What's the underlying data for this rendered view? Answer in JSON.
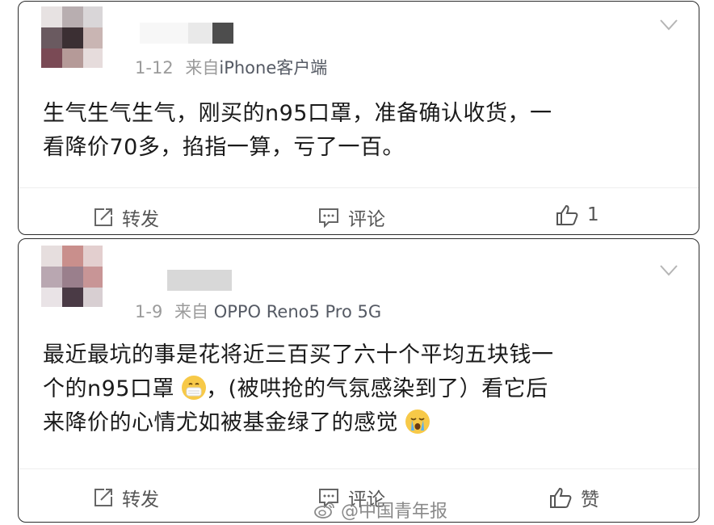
{
  "posts": [
    {
      "meta_date": "1-12",
      "meta_from": "来自",
      "meta_source": "iPhone客户端",
      "content_lines": [
        "生气生气生气，刚买的n95口罩，准备确认收货，一",
        "看降价70多，掐指一算，亏了一百。"
      ],
      "actions": {
        "repost": "转发",
        "comment": "评论",
        "like": "1"
      }
    },
    {
      "meta_date": "1-9",
      "meta_from": "来自",
      "meta_source": "OPPO Reno5 Pro 5G",
      "content_line1": "最近最坑的事是花将近三百买了六十个平均五块钱一",
      "content_line2a": "个的n95口罩",
      "content_line2b": "，(被哄抢的气氛感染到了）看它后",
      "content_line3": "来降价的心情尤如被基金绿了的感觉",
      "actions": {
        "repost": "转发",
        "comment": "评论",
        "like": "赞"
      }
    }
  ],
  "watermark": "@中国青年报",
  "icons": [
    "chevron-down-icon",
    "repost-icon",
    "comment-icon",
    "thumbs-up-icon",
    "mask-emoji-icon",
    "crying-emoji-icon",
    "weibo-logo-icon"
  ]
}
